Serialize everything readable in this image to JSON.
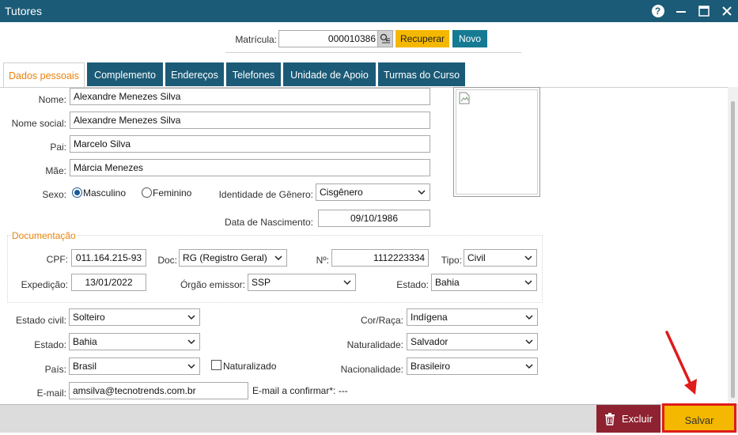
{
  "window": {
    "title": "Tutores"
  },
  "header": {
    "matricula_label": "Matrícula:",
    "matricula_value": "000010386",
    "recuperar_label": "Recuperar",
    "novo_label": "Novo"
  },
  "tabs": [
    {
      "label": "Dados pessoais",
      "active": true
    },
    {
      "label": "Complemento"
    },
    {
      "label": "Endereços"
    },
    {
      "label": "Telefones"
    },
    {
      "label": "Unidade de Apoio"
    },
    {
      "label": "Turmas do Curso"
    }
  ],
  "form": {
    "nome_label": "Nome:",
    "nome_value": "Alexandre Menezes Silva",
    "nome_social_label": "Nome social:",
    "nome_social_value": "Alexandre Menezes Silva",
    "pai_label": "Pai:",
    "pai_value": "Marcelo Silva",
    "mae_label": "Mãe:",
    "mae_value": "Márcia Menezes",
    "sexo_label": "Sexo:",
    "masculino_label": "Masculino",
    "feminino_label": "Feminino",
    "sexo_selected": "Masculino",
    "identidade_label": "Identidade de Gênero:",
    "identidade_value": "Cisgênero",
    "nascimento_label": "Data de Nascimento:",
    "nascimento_value": "09/10/1986"
  },
  "documentacao": {
    "section_label": "Documentação",
    "cpf_label": "CPF:",
    "cpf_value": "011.164.215-93",
    "doc_label": "Doc:",
    "doc_value": "RG (Registro Geral)",
    "numero_label": "Nº:",
    "numero_value": "1112223334",
    "tipo_label": "Tipo:",
    "tipo_value": "Civil",
    "expedicao_label": "Expedição:",
    "expedicao_value": "13/01/2022",
    "orgao_label": "Órgão emissor:",
    "orgao_value": "SSP",
    "estado_label": "Estado:",
    "estado_value": "Bahia"
  },
  "extra": {
    "estado_civil_label": "Estado civil:",
    "estado_civil_value": "Solteiro",
    "cor_label": "Cor/Raça:",
    "cor_value": "Indígena",
    "estado_label": "Estado:",
    "estado_value": "Bahia",
    "naturalidade_label": "Naturalidade:",
    "naturalidade_value": "Salvador",
    "pais_label": "País:",
    "pais_value": "Brasil",
    "naturalizado_label": "Naturalizado",
    "nacionalidade_label": "Nacionalidade:",
    "nacionalidade_value": "Brasileiro",
    "email_label": "E-mail:",
    "email_value": "amsilva@tecnotrends.com.br",
    "email_confirmar": "E-mail a confirmar*: ---"
  },
  "footer": {
    "excluir_label": "Excluir",
    "salvar_label": "Salvar"
  },
  "colors": {
    "titlebar": "#1b5b77",
    "accent_orange": "#e8830c",
    "yellow": "#f5b800",
    "teal": "#167a93",
    "danger": "#8e2230",
    "highlight_red": "#e01b1b"
  }
}
